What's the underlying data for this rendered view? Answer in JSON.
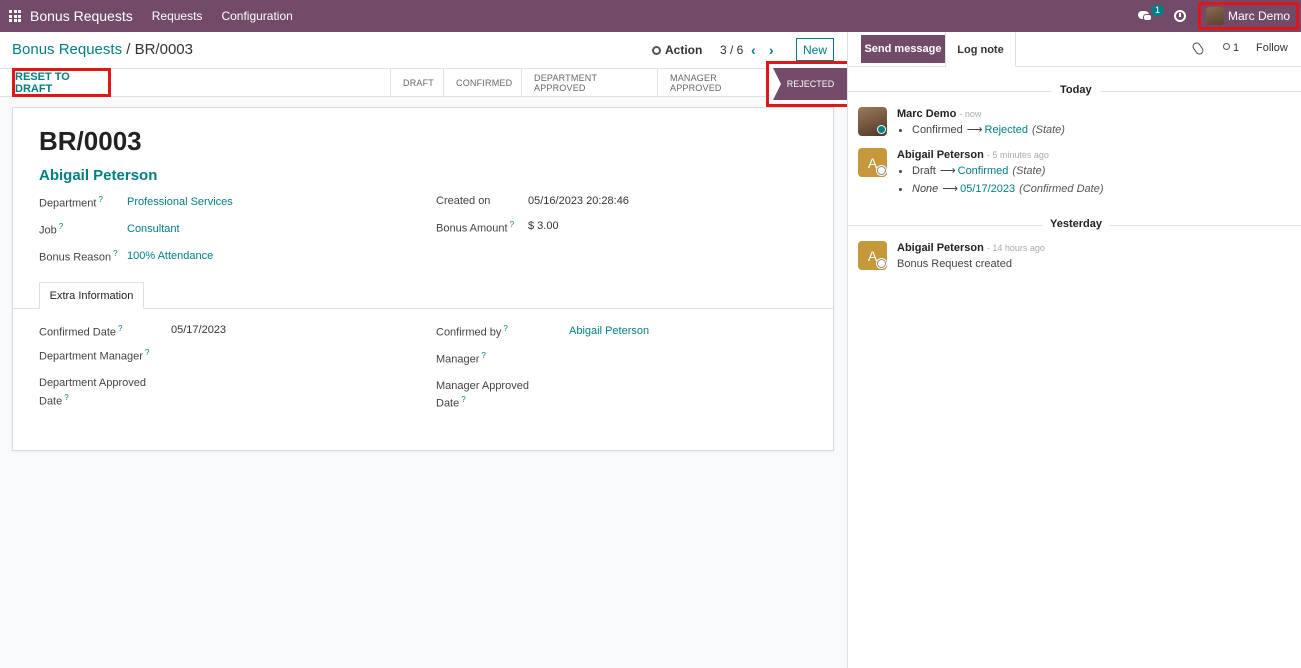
{
  "navbar": {
    "app_title": "Bonus Requests",
    "menu": [
      "Requests",
      "Configuration"
    ],
    "chat_badge": "1",
    "user_name": "Marc Demo"
  },
  "control": {
    "breadcrumb_parent": "Bonus Requests",
    "breadcrumb_sep": "/",
    "breadcrumb_current": "BR/0003",
    "action_label": "Action",
    "pager": "3 / 6",
    "new_label": "New"
  },
  "statusbar": {
    "reset_label": "RESET TO DRAFT",
    "stages": [
      "DRAFT",
      "CONFIRMED",
      "DEPARTMENT APPROVED",
      "MANAGER APPROVED"
    ],
    "current_stage": "REJECTED"
  },
  "form": {
    "name": "BR/0003",
    "employee": "Abigail Peterson",
    "department_label": "Department",
    "department_value": "Professional Services",
    "job_label": "Job",
    "job_value": "Consultant",
    "bonus_reason_label": "Bonus Reason",
    "bonus_reason_value": "100% Attendance",
    "created_on_label": "Created on",
    "created_on_value": "05/16/2023 20:28:46",
    "bonus_amount_label": "Bonus Amount",
    "bonus_amount_value": "$ 3.00",
    "help_mark": "?",
    "tab_label": "Extra Information",
    "confirmed_date_label": "Confirmed Date",
    "confirmed_date_value": "05/17/2023",
    "confirmed_by_label": "Confirmed by",
    "confirmed_by_value": "Abigail Peterson",
    "dept_manager_label": "Department Manager",
    "manager_label": "Manager",
    "dept_approved_date_label_1": "Department Approved",
    "dept_approved_date_label_2": "Date",
    "manager_approved_date_label_1": "Manager Approved",
    "manager_approved_date_label_2": "Date"
  },
  "chatter": {
    "send_message": "Send message",
    "log_note": "Log note",
    "followers_count": "1",
    "follow": "Follow",
    "today": "Today",
    "yesterday": "Yesterday",
    "messages": [
      {
        "author": "Marc Demo",
        "time": "- now",
        "lines": [
          {
            "old": "Confirmed",
            "arrow": "⟶",
            "new": "Rejected",
            "field": "(State)"
          }
        ]
      },
      {
        "author": "Abigail Peterson",
        "initial": "A",
        "time": "- 5 minutes ago",
        "lines": [
          {
            "old": "Draft",
            "arrow": "⟶",
            "new": "Confirmed",
            "field": "(State)"
          },
          {
            "old": "None",
            "arrow": "⟶",
            "new": "05/17/2023",
            "field": "(Confirmed Date)"
          }
        ]
      },
      {
        "author": "Abigail Peterson",
        "initial": "A",
        "time": "- 14 hours ago",
        "body": "Bonus Request created"
      }
    ]
  }
}
